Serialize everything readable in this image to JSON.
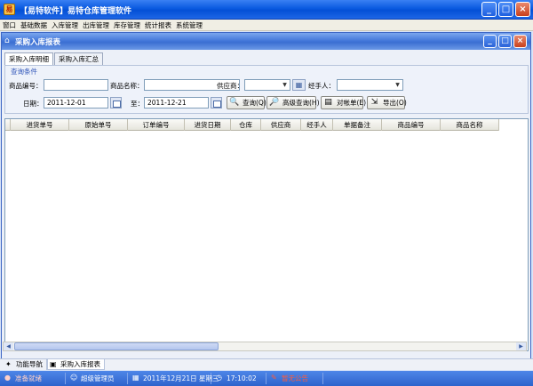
{
  "window": {
    "title": "【易特软件】易特仓库管理软件",
    "minimize": "_",
    "maximize": "□",
    "close": "×"
  },
  "menu": [
    "窗口",
    "基础数据",
    "入库管理",
    "出库管理",
    "库存管理",
    "统计报表",
    "系统管理"
  ],
  "inner_window": {
    "title": "采购入库报表",
    "minimize": "_",
    "maximize": "□",
    "close": "×"
  },
  "tabs": [
    "采购入库明细",
    "采购入库汇总"
  ],
  "query": {
    "legend": "查询条件",
    "product_code_label": "商品编号：",
    "product_code_value": "",
    "product_name_label": "商品名称：",
    "product_name_value": "",
    "supplier_label": "供应商：",
    "supplier_value": "",
    "handler_label": "经手人：",
    "handler_value": "",
    "date_label": "日期：",
    "date_from": "2011-12-01",
    "to_label": "至：",
    "date_to": "2011-12-21",
    "buttons": {
      "query": "查询(Q)",
      "advanced": "高级查询(H)",
      "statement": "对帐单(E)",
      "export": "导出(O)"
    }
  },
  "grid": {
    "columns": [
      "进货单号",
      "原始单号",
      "订单编号",
      "进货日期",
      "仓库",
      "供应商",
      "经手人",
      "单据备注",
      "商品编号",
      "商品名称"
    ],
    "rows": []
  },
  "bottom_tabs": [
    "功能导航",
    "采购入库报表"
  ],
  "status": {
    "ready": "准备就绪",
    "user": "超级管理员",
    "date": "2011年12月21日 星期三",
    "time": "17:10:02",
    "notice": "暂无公告"
  },
  "icons": [
    "app-logo-icon",
    "home-icon",
    "calendar-icon",
    "search-icon",
    "advanced-search-icon",
    "statement-icon",
    "export-icon",
    "nav-icon",
    "report-icon",
    "status-icon",
    "user-icon",
    "clock-icon",
    "notice-icon"
  ]
}
